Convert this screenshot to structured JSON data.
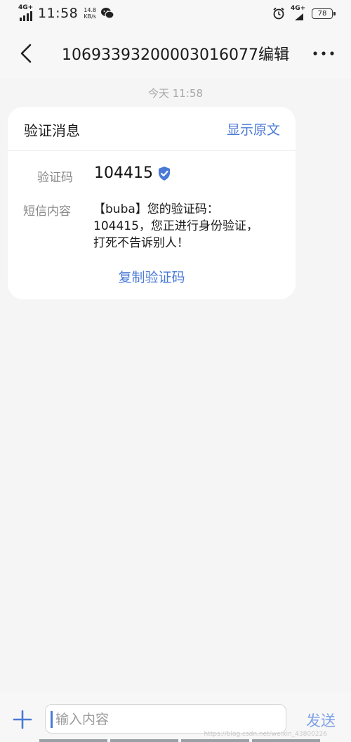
{
  "status_bar": {
    "network_left": "4G+",
    "time": "11:58",
    "speed_value": "14.8",
    "speed_unit": "KB/s",
    "network_right": "4G+",
    "battery": "78"
  },
  "header": {
    "title": "1069339320000301607​7编辑"
  },
  "conversation": {
    "timestamp": "今天 11:58"
  },
  "card": {
    "title": "验证消息",
    "show_original": "显示原文",
    "code_label": "验证码",
    "code_value": "104415",
    "sms_label": "短信内容",
    "sms_lines": [
      "【buba】您的验证码：",
      "104415，您正进行身份验证，",
      "打死不告诉别人！"
    ],
    "copy_label": "复制验证码"
  },
  "composer": {
    "placeholder": "输入内容",
    "send_label": "发送"
  },
  "watermark": "https://blog.csdn.net/weixin_43800226",
  "colors": {
    "accent": "#4a7ad6",
    "background": "#f5f5f5",
    "card": "#ffffff"
  }
}
